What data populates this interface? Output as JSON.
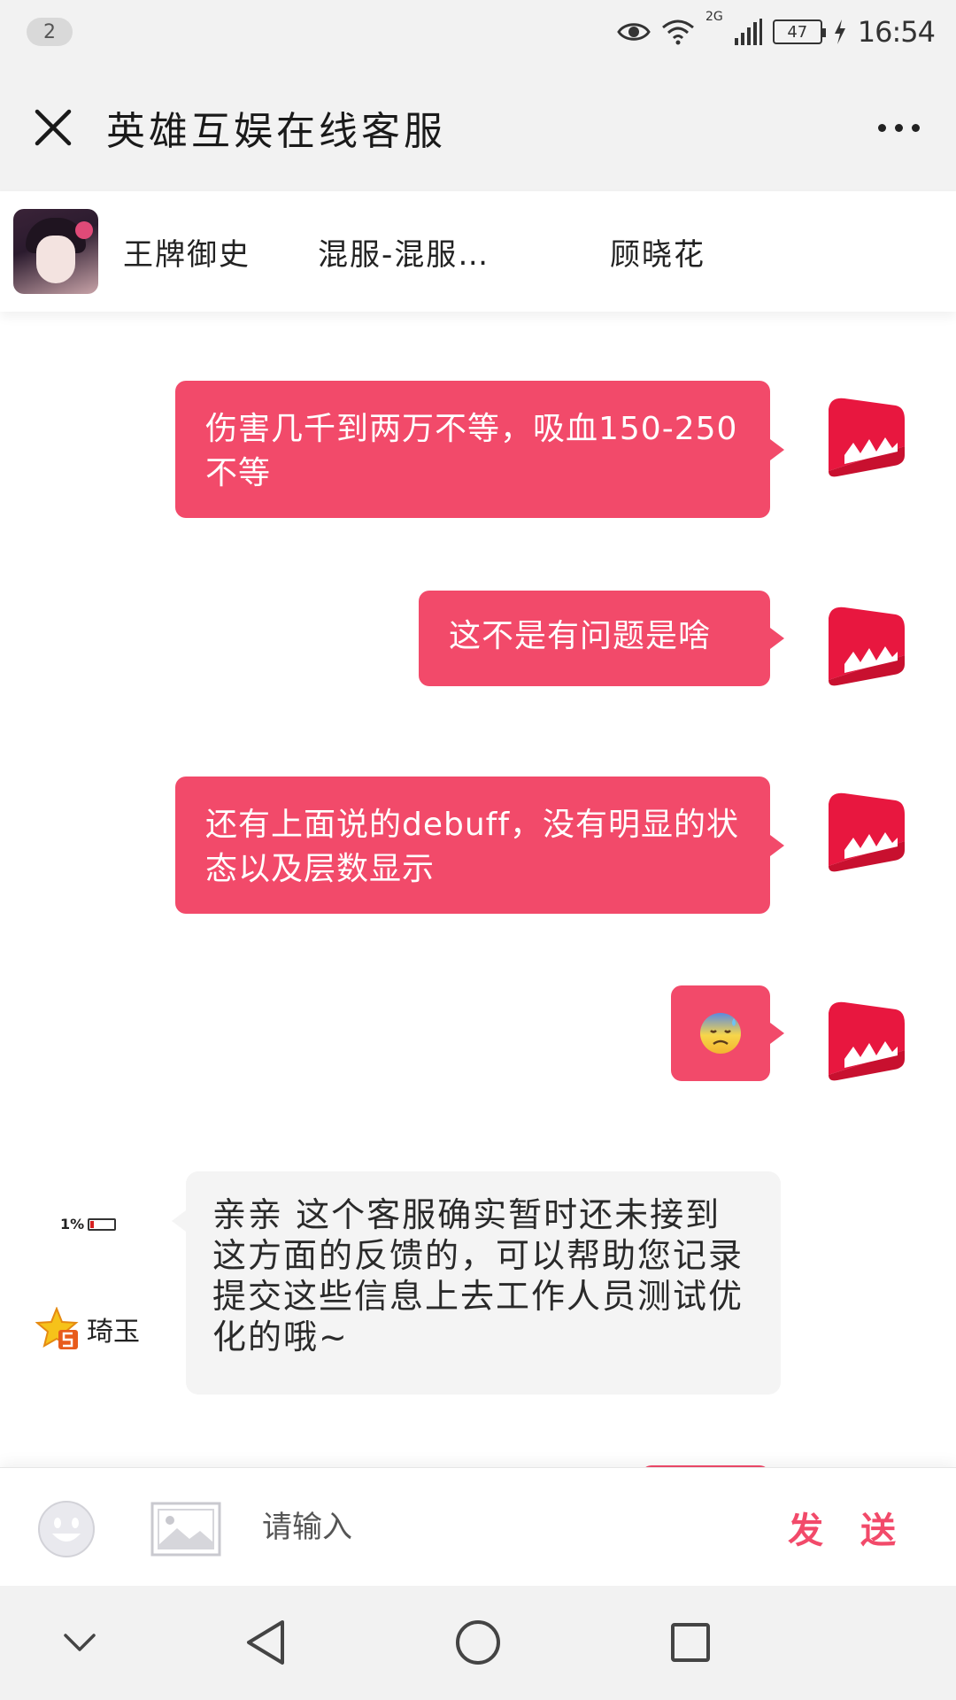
{
  "status_bar": {
    "notification_count": "2",
    "network_label": "2G",
    "battery_level": "47",
    "time": "16:54"
  },
  "title_bar": {
    "title": "英雄互娱在线客服",
    "more_icon": "more-icon",
    "close_icon": "close-icon"
  },
  "info_bar": {
    "game": "王牌御史",
    "server": "混服-混服…",
    "role": "顾晓花"
  },
  "chat": {
    "messages_out": [
      {
        "text": "伤害几千到两万不等，吸血150-250不等"
      },
      {
        "text": "这不是有问题是啥"
      },
      {
        "text": "还有上面说的debuff，没有明显的状态以及层数显示"
      },
      {
        "text": "",
        "emoji": "cold-sweat-emoji"
      }
    ],
    "message_in": {
      "battery_label": "1%",
      "agent_name": "琦玉",
      "text": "亲亲 这个客服确实暂时还未接到这方面的反馈的，可以帮助您记录提交这些信息上去工作人员测试优化的哦~"
    }
  },
  "input_bar": {
    "placeholder": "请输入",
    "value": "",
    "send_label": "发 送",
    "emoji_icon": "smiley-icon",
    "image_icon": "image-icon"
  },
  "colors": {
    "accent": "#f24a6a",
    "bar_bg": "#f2f2f2",
    "incoming_bg": "#f4f4f4"
  }
}
